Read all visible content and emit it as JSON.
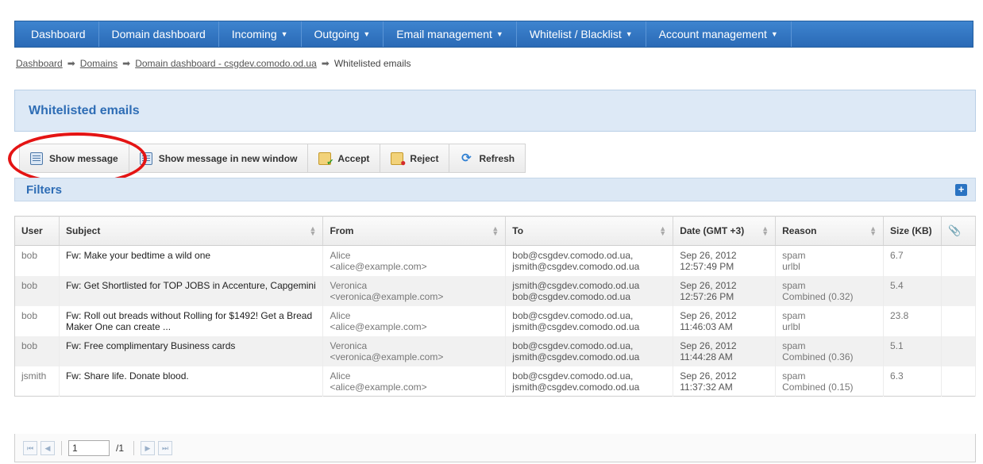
{
  "nav": {
    "items": [
      {
        "label": "Dashboard",
        "dropdown": false
      },
      {
        "label": "Domain dashboard",
        "dropdown": false
      },
      {
        "label": "Incoming",
        "dropdown": true
      },
      {
        "label": "Outgoing",
        "dropdown": true
      },
      {
        "label": "Email management",
        "dropdown": true
      },
      {
        "label": "Whitelist / Blacklist",
        "dropdown": true
      },
      {
        "label": "Account management",
        "dropdown": true
      }
    ]
  },
  "breadcrumb": {
    "items": [
      "Dashboard",
      "Domains",
      "Domain dashboard - csgdev.comodo.od.ua"
    ],
    "current": "Whitelisted emails"
  },
  "page": {
    "title": "Whitelisted emails"
  },
  "toolbar": {
    "show_message": "Show message",
    "show_message_new_window": "Show message in new window",
    "accept": "Accept",
    "reject": "Reject",
    "refresh": "Refresh"
  },
  "filters": {
    "label": "Filters"
  },
  "table": {
    "columns": [
      "User",
      "Subject",
      "From",
      "To",
      "Date (GMT +3)",
      "Reason",
      "Size (KB)"
    ],
    "rows": [
      {
        "user": "bob",
        "subject": "Fw: Make your bedtime a wild one",
        "from_name": "Alice",
        "from_email": "<alice@example.com>",
        "to_1": "bob@csgdev.comodo.od.ua,",
        "to_2": "jsmith@csgdev.comodo.od.ua",
        "date": "Sep 26, 2012",
        "time": "12:57:49 PM",
        "reason": "spam",
        "reason_detail": "urlbl",
        "size": "6.7"
      },
      {
        "user": "bob",
        "subject": "Fw: Get Shortlisted for TOP JOBS in Accenture, Capgemini",
        "from_name": "Veronica",
        "from_email": "<veronica@example.com>",
        "to_1": "jsmith@csgdev.comodo.od.ua",
        "to_2": "bob@csgdev.comodo.od.ua",
        "date": "Sep 26, 2012",
        "time": "12:57:26 PM",
        "reason": "spam",
        "reason_detail": "Combined (0.32)",
        "size": "5.4"
      },
      {
        "user": "bob",
        "subject": "Fw: Roll out breads without Rolling for $1492! Get a Bread Maker One can create ...",
        "from_name": "Alice",
        "from_email": "<alice@example.com>",
        "to_1": "bob@csgdev.comodo.od.ua,",
        "to_2": "jsmith@csgdev.comodo.od.ua",
        "date": "Sep 26, 2012",
        "time": "11:46:03 AM",
        "reason": "spam",
        "reason_detail": "urlbl",
        "size": "23.8"
      },
      {
        "user": "bob",
        "subject": "Fw: Free complimentary Business cards",
        "from_name": "Veronica",
        "from_email": "<veronica@example.com>",
        "to_1": "bob@csgdev.comodo.od.ua,",
        "to_2": "jsmith@csgdev.comodo.od.ua",
        "date": "Sep 26, 2012",
        "time": "11:44:28 AM",
        "reason": "spam",
        "reason_detail": "Combined (0.36)",
        "size": "5.1"
      },
      {
        "user": "jsmith",
        "subject": "Fw: Share life. Donate blood.",
        "from_name": "Alice",
        "from_email": "<alice@example.com>",
        "to_1": "bob@csgdev.comodo.od.ua,",
        "to_2": "jsmith@csgdev.comodo.od.ua",
        "date": "Sep 26, 2012",
        "time": "11:37:32 AM",
        "reason": "spam",
        "reason_detail": "Combined (0.15)",
        "size": "6.3"
      }
    ]
  },
  "pager": {
    "page": "1",
    "total": "/1"
  },
  "colors": {
    "accent": "#2e6db5",
    "nav_bg": "#2a6ab6",
    "annotation": "#e41414"
  }
}
